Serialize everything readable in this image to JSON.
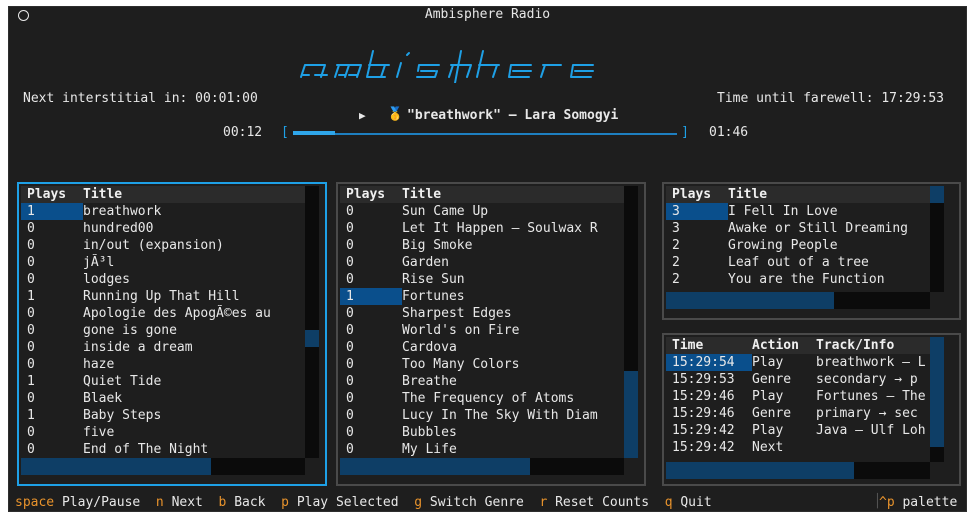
{
  "window": {
    "title": "Ambisphere Radio"
  },
  "logo": {
    "text": "ambisphere"
  },
  "header": {
    "interstitial_label": "Next interstitial in: 00:01:00",
    "farewell_label": "Time until farewell: 17:29:53",
    "now_playing_icon": "play-triangle",
    "medal_icon": "🥇",
    "now_playing": "\"breathwork\" – Lara Somogyi",
    "elapsed": "00:12",
    "duration": "01:46",
    "progress_fraction": 0.11,
    "bar_left": "[",
    "bar_right": "]"
  },
  "colors": {
    "accent": "#1ea0e6",
    "highlight": "#0a4f8c",
    "key": "#e8932c"
  },
  "panel1": {
    "headers": [
      "Plays",
      "Title"
    ],
    "rows": [
      [
        "1",
        "breathwork"
      ],
      [
        "0",
        "hundred00"
      ],
      [
        "0",
        "in/out (expansion)"
      ],
      [
        "0",
        "jÃ³l"
      ],
      [
        "0",
        "lodges"
      ],
      [
        "1",
        "Running Up That Hill"
      ],
      [
        "0",
        "Apologie des ApogÃ©es au"
      ],
      [
        "0",
        "gone is gone"
      ],
      [
        "0",
        "inside a dream"
      ],
      [
        "0",
        "haze"
      ],
      [
        "1",
        "Quiet Tide"
      ],
      [
        "0",
        "Blaek"
      ],
      [
        "1",
        "Baby Steps"
      ],
      [
        "0",
        "five"
      ],
      [
        "0",
        "End of The Night"
      ]
    ]
  },
  "panel2": {
    "headers": [
      "Plays",
      "Title"
    ],
    "rows": [
      [
        "0",
        "Sun Came Up"
      ],
      [
        "0",
        "Let It Happen – Soulwax R"
      ],
      [
        "0",
        "Big Smoke"
      ],
      [
        "0",
        "Garden"
      ],
      [
        "0",
        "Rise Sun"
      ],
      [
        "1",
        "Fortunes"
      ],
      [
        "0",
        "Sharpest Edges"
      ],
      [
        "0",
        "World's on Fire"
      ],
      [
        "0",
        "Cardova"
      ],
      [
        "0",
        "Too Many Colors"
      ],
      [
        "0",
        "Breathe"
      ],
      [
        "0",
        "The Frequency of Atoms"
      ],
      [
        "0",
        "Lucy In The Sky With Diam"
      ],
      [
        "0",
        "Bubbles"
      ],
      [
        "0",
        "My Life"
      ]
    ]
  },
  "panel3": {
    "headers": [
      "Plays",
      "Title"
    ],
    "rows": [
      [
        "3",
        "I Fell In Love"
      ],
      [
        "3",
        "Awake or Still Dreaming"
      ],
      [
        "2",
        "Growing People"
      ],
      [
        "2",
        "Leaf out of a tree"
      ],
      [
        "2",
        "You are the Function"
      ]
    ]
  },
  "panel4": {
    "headers": [
      "Time",
      "Action",
      "Track/Info"
    ],
    "rows": [
      [
        "15:29:54",
        "Play",
        "breathwork – L"
      ],
      [
        "15:29:53",
        "Genre",
        "secondary → p"
      ],
      [
        "15:29:46",
        "Play",
        "Fortunes – The"
      ],
      [
        "15:29:46",
        "Genre",
        "primary → sec"
      ],
      [
        "15:29:42",
        "Play",
        "Java – Ulf Loh"
      ],
      [
        "15:29:42",
        "Next",
        ""
      ]
    ]
  },
  "footer": {
    "keys": [
      {
        "key": "space",
        "label": "Play/Pause"
      },
      {
        "key": "n",
        "label": "Next"
      },
      {
        "key": "b",
        "label": "Back"
      },
      {
        "key": "p",
        "label": "Play Selected"
      },
      {
        "key": "g",
        "label": "Switch Genre"
      },
      {
        "key": "r",
        "label": "Reset Counts"
      },
      {
        "key": "q",
        "label": "Quit"
      }
    ],
    "palette_key": "^p",
    "palette_label": "palette"
  }
}
